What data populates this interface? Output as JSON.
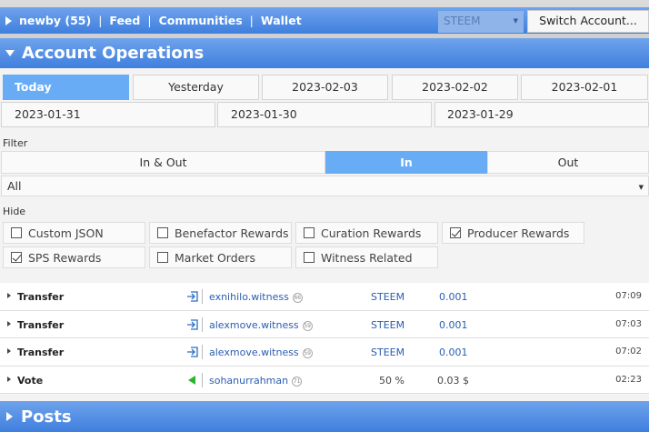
{
  "nav": {
    "user": "newby (55)",
    "links": [
      "Feed",
      "Communities",
      "Wallet"
    ],
    "separator": "|",
    "chain_select": "STEEM",
    "switch_account": "Switch Account..."
  },
  "account_operations": {
    "title": "Account Operations",
    "dates": [
      "Today",
      "Yesterday",
      "2023-02-03",
      "2023-02-02",
      "2023-02-01",
      "2023-01-31",
      "2023-01-30",
      "2023-01-29"
    ],
    "active_date": "Today",
    "filter": {
      "label": "Filter",
      "direction": [
        "In & Out",
        "In",
        "Out"
      ],
      "active_direction": "In",
      "type_select": "All"
    },
    "hide": {
      "label": "Hide",
      "options": [
        {
          "label": "Custom JSON",
          "checked": false
        },
        {
          "label": "Benefactor Rewards",
          "checked": false
        },
        {
          "label": "Curation Rewards",
          "checked": false
        },
        {
          "label": "Producer Rewards",
          "checked": true
        },
        {
          "label": "SPS Rewards",
          "checked": true
        },
        {
          "label": "Market Orders",
          "checked": false
        },
        {
          "label": "Witness Related",
          "checked": false
        }
      ]
    },
    "operations": [
      {
        "type": "Transfer",
        "icon": "incoming-arrow-icon",
        "account": "exnihilo.witness",
        "rep": "66",
        "col1": "STEEM",
        "col2": "0.001",
        "time": "07:09"
      },
      {
        "type": "Transfer",
        "icon": "incoming-arrow-icon",
        "account": "alexmove.witness",
        "rep": "59",
        "col1": "STEEM",
        "col2": "0.001",
        "time": "07:03"
      },
      {
        "type": "Transfer",
        "icon": "incoming-arrow-icon",
        "account": "alexmove.witness",
        "rep": "59",
        "col1": "STEEM",
        "col2": "0.001",
        "time": "07:02"
      },
      {
        "type": "Vote",
        "icon": "vote-triangle-icon",
        "account": "sohanurrahman",
        "rep": "71",
        "col1": "50 %",
        "col2": "0.03 $",
        "time": "02:23"
      }
    ]
  },
  "posts": {
    "title": "Posts"
  },
  "colors": {
    "nav_blue": "#3f7fde",
    "active_blue": "#68acf6",
    "link_blue": "#2a5db0",
    "vote_green": "#2bb52b"
  }
}
